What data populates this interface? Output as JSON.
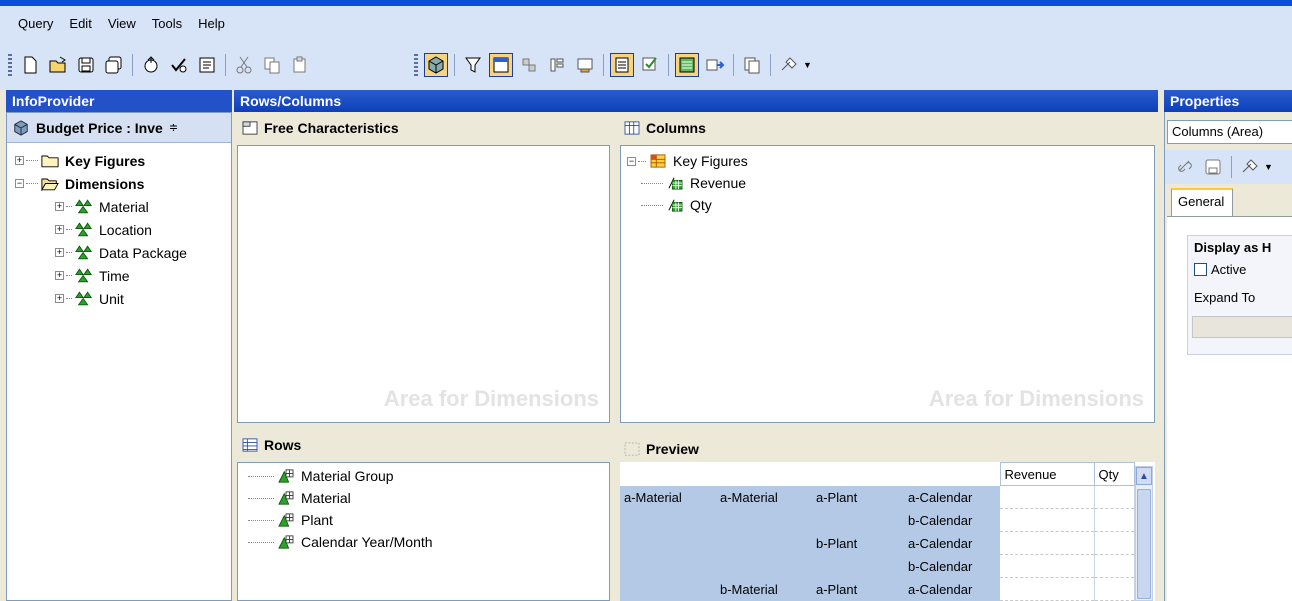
{
  "menu": [
    "Query",
    "Edit",
    "View",
    "Tools",
    "Help"
  ],
  "panels": {
    "infoprovider": "InfoProvider",
    "rows_columns": "Rows/Columns",
    "properties": "Properties"
  },
  "infoprovider": {
    "header": "Budget Price : Inve",
    "sort_glyph": "≑",
    "tree": {
      "key_figures": "Key Figures",
      "dimensions": "Dimensions",
      "children": [
        "Material",
        "Location",
        "Data Package",
        "Time",
        "Unit"
      ]
    }
  },
  "areas": {
    "free_chars": "Free Characteristics",
    "columns": "Columns",
    "rows": "Rows",
    "preview": "Preview",
    "watermark": "Area for Dimensions"
  },
  "columns_tree": {
    "root": "Key Figures",
    "items": [
      "Revenue",
      "Qty"
    ]
  },
  "rows_list": [
    "Material Group",
    "Material",
    "Plant",
    "Calendar Year/Month"
  ],
  "preview": {
    "headers": [
      "Revenue",
      "Qty"
    ],
    "rows": [
      [
        "a-Material",
        "a-Material",
        "a-Plant",
        "a-Calendar"
      ],
      [
        "",
        "",
        "",
        "b-Calendar"
      ],
      [
        "",
        "",
        "b-Plant",
        "a-Calendar"
      ],
      [
        "",
        "",
        "",
        "b-Calendar"
      ],
      [
        "",
        "b-Material",
        "a-Plant",
        "a-Calendar"
      ]
    ]
  },
  "properties": {
    "selected": "Columns (Area)",
    "tab": "General",
    "group_title": "Display as H",
    "checkbox_label": "Active",
    "expand_label": "Expand To"
  }
}
